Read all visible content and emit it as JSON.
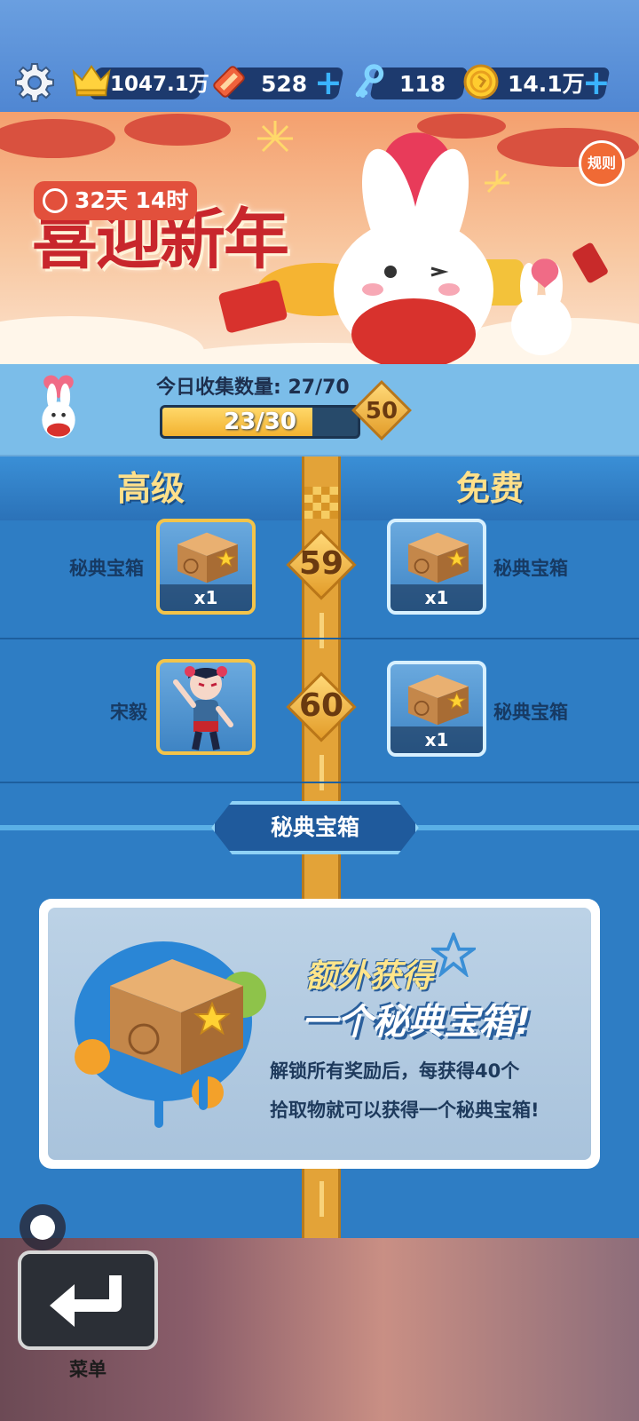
{
  "topbar": {
    "crown_value": "1047.1万",
    "tickets_value": "528",
    "keys_value": "118",
    "coins_value": "14.1万",
    "plus": "+"
  },
  "banner": {
    "title": "喜迎新年",
    "timer": "32天 14时",
    "rules_label": "规则"
  },
  "progress": {
    "collect_label": "今日收集数量: 27/70",
    "bar_text": "23/30",
    "bar_fraction": 0.7667,
    "tier_badge": "50"
  },
  "columns": {
    "premium": "高级",
    "free": "免费"
  },
  "rewards": [
    {
      "level": "59",
      "premium": {
        "name": "秘典宝箱",
        "qty": "x1"
      },
      "free": {
        "name": "秘典宝箱",
        "qty": "x1"
      }
    },
    {
      "level": "60",
      "premium": {
        "name": "宋毅",
        "qty": ""
      },
      "free": {
        "name": "秘典宝箱",
        "qty": "x1"
      }
    }
  ],
  "section": {
    "title": "秘典宝箱"
  },
  "info_card": {
    "headline_1": "额外获得",
    "headline_2": "一个秘典宝箱!",
    "desc_line_1": "解锁所有奖励后，每获得40个",
    "desc_line_2": "拾取物就可以获得一个秘典宝箱!"
  },
  "bottom": {
    "menu_label": "菜单"
  },
  "colors": {
    "panel_blue": "#2e7dc4",
    "road_gold": "#e3a338",
    "premium_border": "#f3c44a",
    "free_border": "#d7f0ff",
    "header_text": "#ffe08a"
  }
}
